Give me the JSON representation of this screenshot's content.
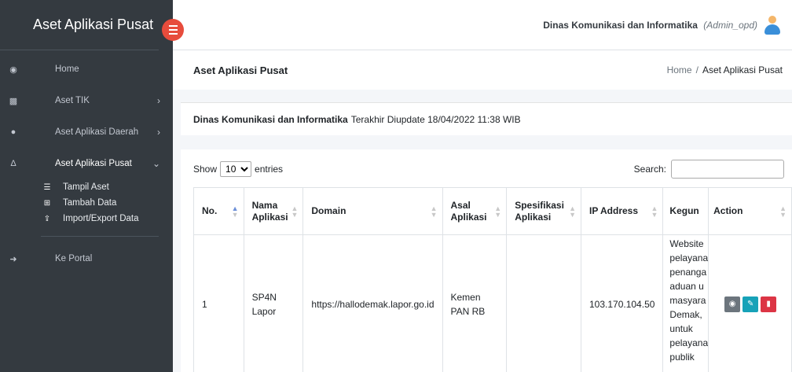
{
  "sidebar": {
    "brand": "Aset Aplikasi Pusat",
    "items": [
      {
        "label": "Home",
        "icon": "dashboard-icon"
      },
      {
        "label": "Aset TIK",
        "icon": "briefcase-icon"
      },
      {
        "label": "Aset Aplikasi Daerah",
        "icon": "android-icon"
      },
      {
        "label": "Aset Aplikasi Pusat",
        "icon": "apple-icon"
      }
    ],
    "sub_items": [
      {
        "label": "Tampil Aset",
        "icon": "list-icon"
      },
      {
        "label": "Tambah Data",
        "icon": "plus-square-icon"
      },
      {
        "label": "Import/Export Data",
        "icon": "upload-icon"
      }
    ],
    "portal": {
      "label": "Ke Portal",
      "icon": "sign-in-icon"
    }
  },
  "topbar": {
    "org": "Dinas Komunikasi dan Informatika",
    "role": "(Admin_opd)"
  },
  "header": {
    "title": "Aset Aplikasi Pusat",
    "breadcrumb_home": "Home",
    "breadcrumb_sep": "/",
    "breadcrumb_current": "Aset Aplikasi Pusat"
  },
  "info": {
    "org": "Dinas Komunikasi dan Informatika",
    "updated": "Terakhir Diupdate 18/04/2022 11:38 WIB"
  },
  "table_controls": {
    "show_label": "Show",
    "entries_value": "10",
    "entries_label": "entries",
    "search_label": "Search:"
  },
  "table": {
    "columns": [
      "No.",
      "Nama Aplikasi",
      "Domain",
      "Asal Aplikasi",
      "Spesifikasi Aplikasi",
      "IP Address",
      "Kegun",
      "Action"
    ],
    "rows": [
      {
        "no": "1",
        "nama": "SP4N Lapor",
        "domain": "https://hallodemak.lapor.go.id",
        "asal": "Kemen PAN RB",
        "spesifikasi": "",
        "ip": "103.170.104.50",
        "kegunaan": [
          "Website",
          "pelayana",
          "penanga",
          "aduan u",
          "masyara",
          "Demak,",
          "untuk",
          "pelayana",
          "publik"
        ]
      }
    ]
  },
  "colors": {
    "sidebar": "#343a40",
    "toggle": "#e74c3c",
    "teal": "#17a2b8",
    "red": "#dc3545",
    "gray": "#6c757d"
  }
}
